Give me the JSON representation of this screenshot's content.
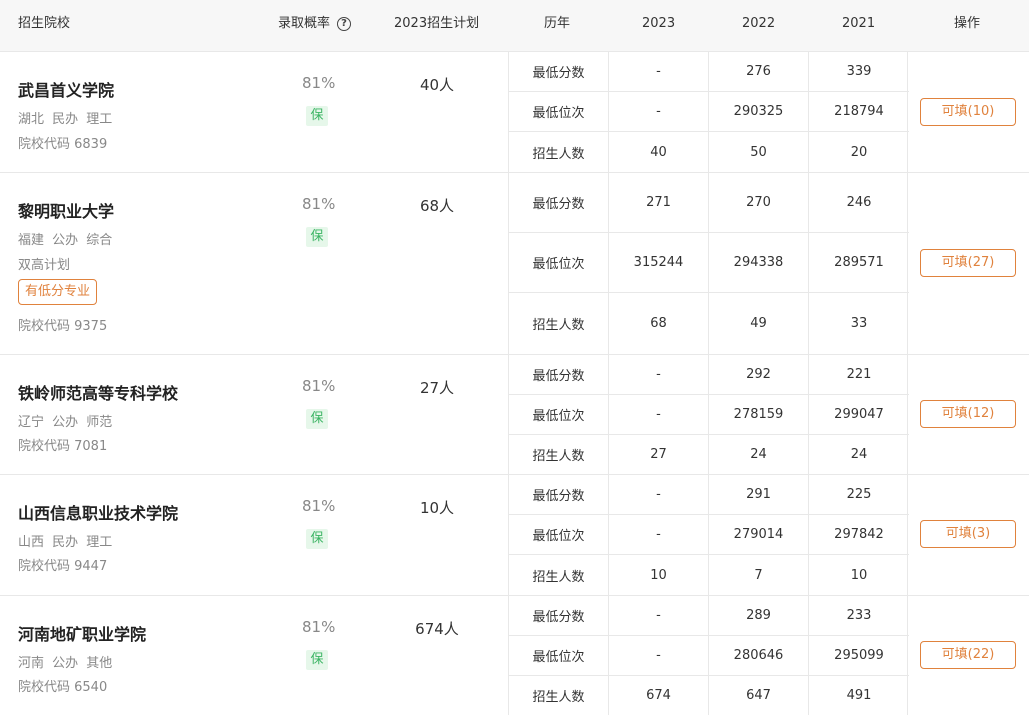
{
  "header": {
    "school": "招生院校",
    "probability": "录取概率",
    "plan": "2023招生计划",
    "history": "历年",
    "years": [
      "2023",
      "2022",
      "2021"
    ],
    "operation": "操作"
  },
  "colors": {
    "accent": "#e0823d",
    "safe_bg": "#e6f7ea",
    "safe_text": "#3bb463"
  },
  "schools": [
    {
      "name": "武昌首义学院",
      "tags": "湖北 民办 理工",
      "code": "院校代码 6839",
      "probability": "81%",
      "safety": "保",
      "plan": "40人",
      "rows": [
        {
          "label": "最低分数",
          "values": [
            "-",
            "276",
            "339"
          ]
        },
        {
          "label": "最低位次",
          "values": [
            "-",
            "290325",
            "218794"
          ]
        },
        {
          "label": "招生人数",
          "values": [
            "40",
            "50",
            "20"
          ]
        }
      ],
      "fill_label": "可填(10)"
    },
    {
      "name": "黎明职业大学",
      "tags": "福建 公办 综合",
      "extra": "双高计划",
      "badge": "有低分专业",
      "code": "院校代码 9375",
      "probability": "81%",
      "safety": "保",
      "plan": "68人",
      "rows": [
        {
          "label": "最低分数",
          "values": [
            "271",
            "270",
            "246"
          ]
        },
        {
          "label": "最低位次",
          "values": [
            "315244",
            "294338",
            "289571"
          ]
        },
        {
          "label": "招生人数",
          "values": [
            "68",
            "49",
            "33"
          ]
        }
      ],
      "fill_label": "可填(27)"
    },
    {
      "name": "铁岭师范高等专科学校",
      "tags": "辽宁 公办 师范",
      "code": "院校代码 7081",
      "probability": "81%",
      "safety": "保",
      "plan": "27人",
      "rows": [
        {
          "label": "最低分数",
          "values": [
            "-",
            "292",
            "221"
          ]
        },
        {
          "label": "最低位次",
          "values": [
            "-",
            "278159",
            "299047"
          ]
        },
        {
          "label": "招生人数",
          "values": [
            "27",
            "24",
            "24"
          ]
        }
      ],
      "fill_label": "可填(12)"
    },
    {
      "name": "山西信息职业技术学院",
      "tags": "山西 民办 理工",
      "code": "院校代码 9447",
      "probability": "81%",
      "safety": "保",
      "plan": "10人",
      "rows": [
        {
          "label": "最低分数",
          "values": [
            "-",
            "291",
            "225"
          ]
        },
        {
          "label": "最低位次",
          "values": [
            "-",
            "279014",
            "297842"
          ]
        },
        {
          "label": "招生人数",
          "values": [
            "10",
            "7",
            "10"
          ]
        }
      ],
      "fill_label": "可填(3)"
    },
    {
      "name": "河南地矿职业学院",
      "tags": "河南 公办 其他",
      "code": "院校代码 6540",
      "probability": "81%",
      "safety": "保",
      "plan": "674人",
      "rows": [
        {
          "label": "最低分数",
          "values": [
            "-",
            "289",
            "233"
          ]
        },
        {
          "label": "最低位次",
          "values": [
            "-",
            "280646",
            "295099"
          ]
        },
        {
          "label": "招生人数",
          "values": [
            "674",
            "647",
            "491"
          ]
        }
      ],
      "fill_label": "可填(22)"
    }
  ]
}
